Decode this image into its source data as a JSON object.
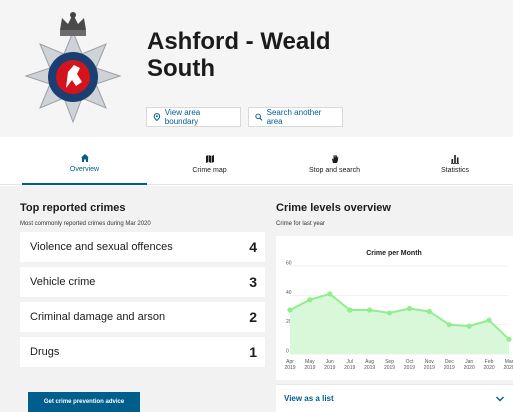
{
  "header": {
    "area_name": "Ashford - Weald South",
    "buttons": [
      {
        "label": "View area boundary",
        "icon": "location-pin-icon"
      },
      {
        "label": "Search another area",
        "icon": "search-icon"
      }
    ]
  },
  "tabs": [
    {
      "label": "Overview",
      "icon": "home-icon",
      "active": true
    },
    {
      "label": "Crime map",
      "icon": "map-icon",
      "active": false
    },
    {
      "label": "Stop and search",
      "icon": "hand-icon",
      "active": false
    },
    {
      "label": "Statistics",
      "icon": "bar-chart-icon",
      "active": false
    }
  ],
  "top_crimes": {
    "title": "Top reported crimes",
    "subtitle": "Most commonly reported crimes during Mar 2020",
    "items": [
      {
        "name": "Violence and sexual offences",
        "count": "4"
      },
      {
        "name": "Vehicle crime",
        "count": "3"
      },
      {
        "name": "Criminal damage and arson",
        "count": "2"
      },
      {
        "name": "Drugs",
        "count": "1"
      }
    ],
    "advice_button": "Get crime prevention advice"
  },
  "crime_levels": {
    "title": "Crime levels overview",
    "subtitle": "Crime for last year",
    "view_list_label": "View as a list"
  },
  "colors": {
    "accent": "#005e8c",
    "line": "#90ee90",
    "area": "#d9f8d9"
  },
  "chart_data": {
    "type": "area",
    "title": "Crime per Month",
    "categories": [
      [
        "Apr",
        "2019"
      ],
      [
        "May",
        "2019"
      ],
      [
        "Jun",
        "2019"
      ],
      [
        "Jul",
        "2019"
      ],
      [
        "Aug",
        "2019"
      ],
      [
        "Sep",
        "2019"
      ],
      [
        "Oct",
        "2019"
      ],
      [
        "Nov",
        "2019"
      ],
      [
        "Dec",
        "2019"
      ],
      [
        "Jan",
        "2020"
      ],
      [
        "Feb",
        "2020"
      ],
      [
        "Mar",
        "2020"
      ]
    ],
    "series": [
      {
        "values": [
          30,
          37,
          41,
          30,
          30,
          28,
          31,
          29,
          20,
          19,
          23,
          10
        ]
      }
    ],
    "yticks": [
      0,
      20,
      40,
      60
    ],
    "ylim": [
      0,
      60
    ],
    "grid": true
  }
}
